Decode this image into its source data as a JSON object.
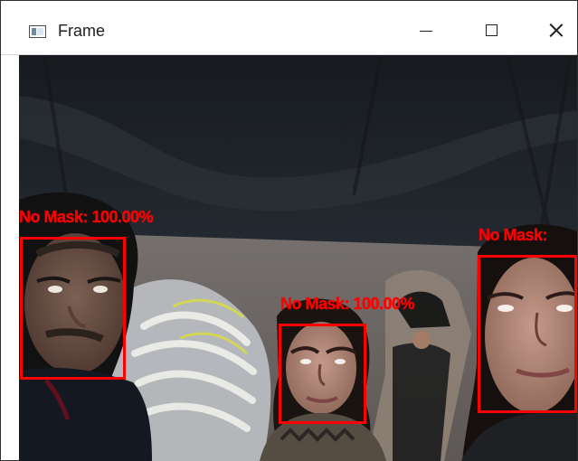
{
  "window": {
    "title": "Frame"
  },
  "colors": {
    "detection_box": "#ff0000",
    "label_text": "#ff0000",
    "titlebar": "#ffffff"
  },
  "icons": {
    "app": "app-window-icon",
    "minimize": "minimize-icon",
    "maximize": "maximize-icon",
    "close": "close-icon"
  },
  "detections": [
    {
      "label": "No Mask: 100.00%"
    },
    {
      "label": "No Mask: 100.00%"
    },
    {
      "label": "No Mask:"
    }
  ]
}
